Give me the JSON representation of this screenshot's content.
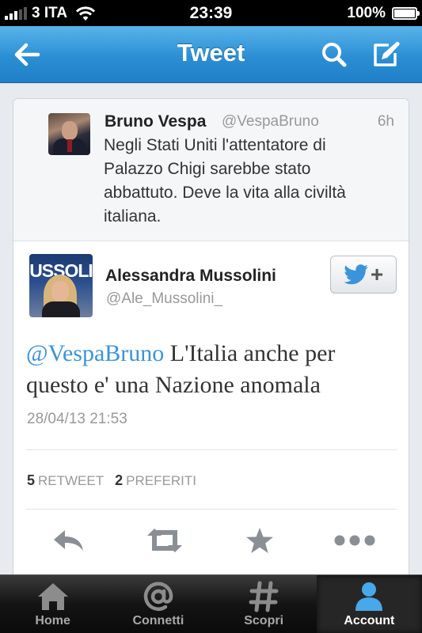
{
  "status_bar": {
    "carrier": "3 ITA",
    "time": "23:39",
    "battery": "100%"
  },
  "nav": {
    "title": "Tweet",
    "icons": [
      "back-arrow-icon",
      "search-icon",
      "compose-icon"
    ]
  },
  "reply_to": {
    "name": "Bruno Vespa",
    "handle": "@VespaBruno",
    "time": "6h",
    "text": "Negli Stati Uniti l'attentatore di Palazzo Chigi sarebbe stato abbattuto. Deve la vita alla civiltà italiana."
  },
  "tweet": {
    "author_name": "Alessandra Mussolini",
    "author_handle": "@Ale_Mussolini_",
    "avatar_banner": "USSOLI",
    "mention": "@VespaBruno",
    "text": " L'Italia anche per questo e' una Nazione anomala",
    "date": "28/04/13 21:53",
    "retweet_count": "5",
    "retweet_label": "RETWEET",
    "favorite_count": "2",
    "favorite_label": "PREFERITI"
  },
  "actions": [
    "reply-icon",
    "retweet-icon",
    "favorite-star-icon",
    "more-icon"
  ],
  "tabs": [
    {
      "label": "Home",
      "icon": "home-icon"
    },
    {
      "label": "Connetti",
      "icon": "at-icon"
    },
    {
      "label": "Scopri",
      "icon": "hash-icon"
    },
    {
      "label": "Account",
      "icon": "person-icon"
    }
  ],
  "colors": {
    "nav_blue": "#2b8fd4",
    "link_blue": "#3b94d9",
    "tab_active_icon": "#48a8e8"
  }
}
